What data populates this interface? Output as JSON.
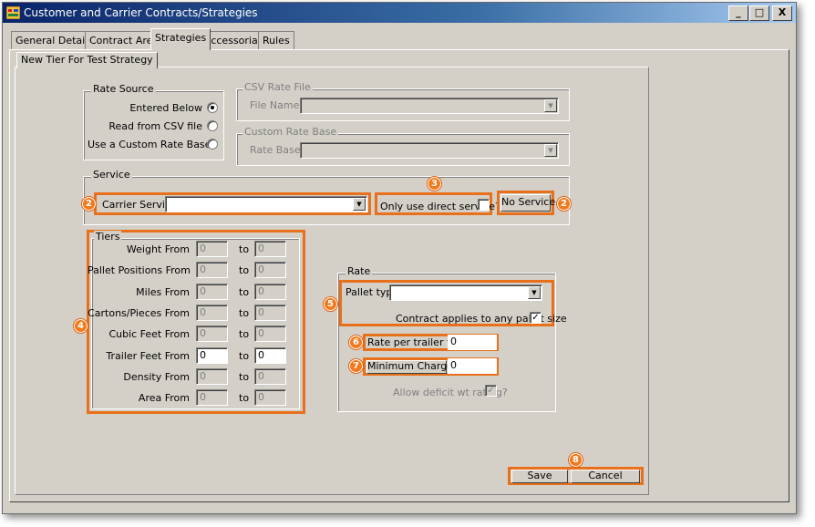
{
  "window": {
    "title": "Customer and Carrier Contracts/Strategies",
    "minimize": "_",
    "maximize": "□",
    "close": "X"
  },
  "tabs": [
    "General Details",
    "Contract Areas",
    "Strategies",
    "Accessorials",
    "Rules"
  ],
  "active_tab": "Strategies",
  "subtab": "New Tier For Test Strategy",
  "rate_source": {
    "title": "Rate Source",
    "options": [
      "Entered Below",
      "Read from CSV file",
      "Use a Custom Rate Base"
    ],
    "selected": "Entered Below"
  },
  "csv_rate_file": {
    "title": "CSV Rate File",
    "file_name_label": "File Name",
    "file_name_value": ""
  },
  "custom_rate_base": {
    "title": "Custom Rate Base",
    "rate_base_label": "Rate Base",
    "rate_base_value": ""
  },
  "service": {
    "title": "Service",
    "carrier_service_label": "Carrier Service",
    "carrier_service_value": "",
    "direct_label": "Only use direct service?",
    "direct_checked": false,
    "no_service_button": "No Service"
  },
  "tiers": {
    "title": "Tiers",
    "to_label": "to",
    "rows": [
      {
        "label": "Weight From",
        "from": "0",
        "to": "0",
        "enabled": false
      },
      {
        "label": "Pallet Positions From",
        "from": "0",
        "to": "0",
        "enabled": false
      },
      {
        "label": "Miles From",
        "from": "0",
        "to": "0",
        "enabled": false
      },
      {
        "label": "Cartons/Pieces From",
        "from": "0",
        "to": "0",
        "enabled": false
      },
      {
        "label": "Cubic Feet From",
        "from": "0",
        "to": "0",
        "enabled": false
      },
      {
        "label": "Trailer Feet From",
        "from": "0",
        "to": "0",
        "enabled": true
      },
      {
        "label": "Density From",
        "from": "0",
        "to": "0",
        "enabled": false
      },
      {
        "label": "Area From",
        "from": "0",
        "to": "0",
        "enabled": false
      }
    ]
  },
  "rate": {
    "title": "Rate",
    "pallet_type_label": "Pallet type",
    "pallet_type_value": "",
    "any_pallet_label": "Contract applies to any pallet size",
    "any_pallet_checked": true,
    "rate_per_trailer_foot_label": "Rate per trailer foot",
    "rate_per_trailer_foot_value": "0",
    "minimum_charge_label": "Minimum Charge",
    "minimum_charge_value": "0",
    "allow_deficit_label": "Allow deficit wt rating?",
    "allow_deficit_checked": true
  },
  "buttons": {
    "save": "Save",
    "cancel": "Cancel"
  },
  "callouts": [
    "2",
    "3",
    "2",
    "4",
    "5",
    "6",
    "7",
    "8"
  ],
  "colors": {
    "callout": "#e8701a",
    "titlebar": "#0a246a",
    "face": "#d4d0c8"
  }
}
